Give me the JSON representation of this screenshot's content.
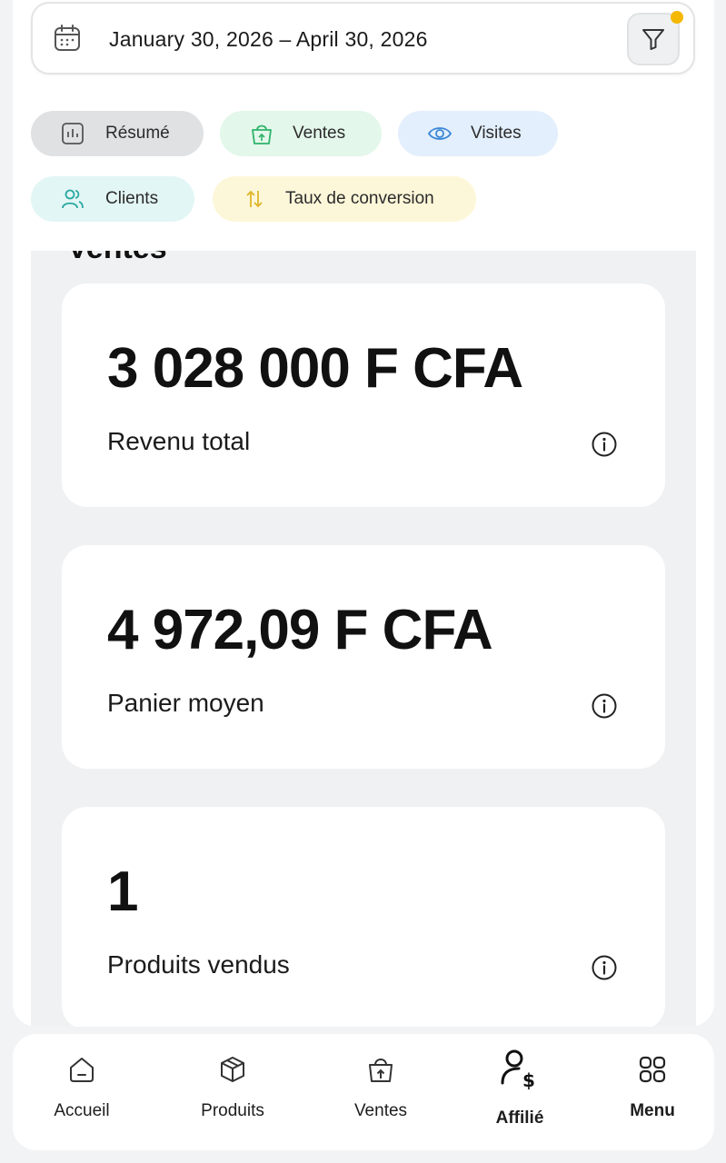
{
  "date_range": {
    "text": "January 30, 2026 – April 30, 2026",
    "filter_active": true
  },
  "tabs": [
    {
      "label": "Résumé",
      "icon": "bar-chart-icon",
      "active": true
    },
    {
      "label": "Ventes",
      "icon": "shopping-bag-icon"
    },
    {
      "label": "Visites",
      "icon": "eye-icon"
    },
    {
      "label": "Clients",
      "icon": "users-icon"
    },
    {
      "label": "Taux de conversion",
      "icon": "arrows-up-down-icon"
    }
  ],
  "section": {
    "title": "Ventes"
  },
  "cards": [
    {
      "value": "3 028 000 F CFA",
      "label": "Revenu total"
    },
    {
      "value": "4 972,09 F CFA",
      "label": "Panier moyen"
    },
    {
      "value": "1",
      "label": "Produits vendus"
    }
  ],
  "bottom_nav": [
    {
      "label": "Accueil",
      "icon": "home-icon"
    },
    {
      "label": "Produits",
      "icon": "box-icon"
    },
    {
      "label": "Ventes",
      "icon": "shopping-bag-icon"
    },
    {
      "label": "Affilié",
      "icon": "affiliate-user-dollar-icon"
    },
    {
      "label": "Menu",
      "icon": "grid-icon"
    }
  ],
  "colors": {
    "filter_dot": "#f5b800",
    "chip_resume": "#dfe1e3",
    "chip_ventes": "#e3f7ea",
    "chip_visites": "#e3effc",
    "chip_clients": "#e2f6f5",
    "chip_taux": "#fdf7d9"
  }
}
